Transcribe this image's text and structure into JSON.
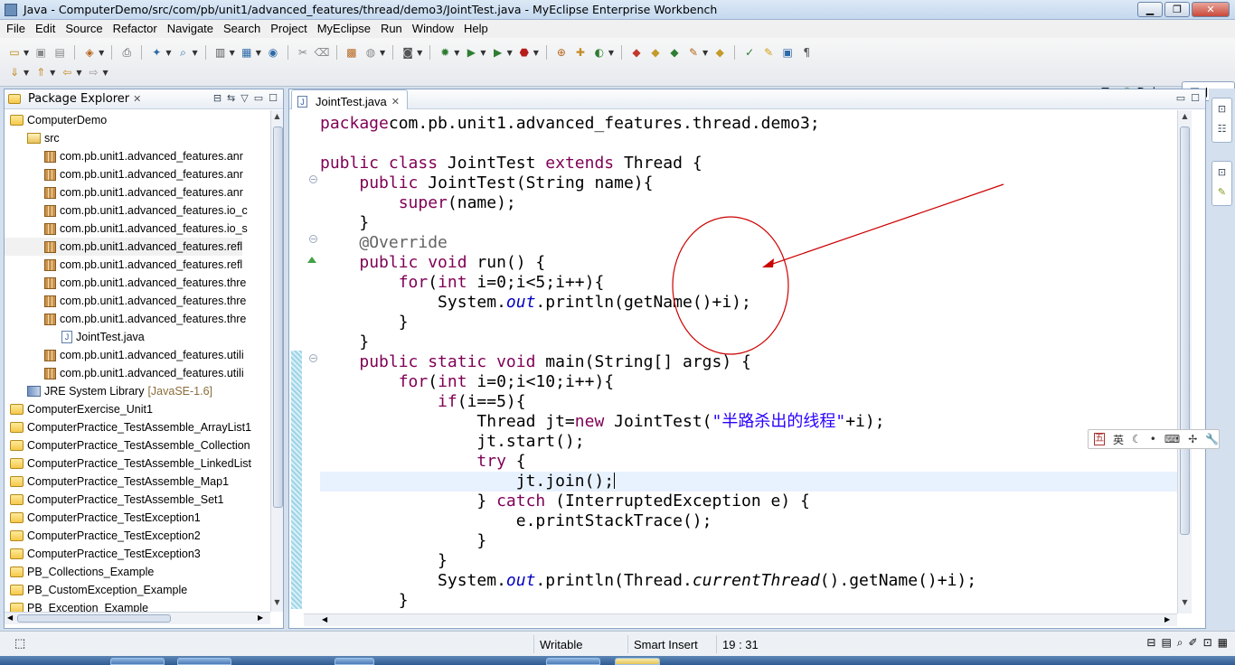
{
  "window": {
    "title": "Java - ComputerDemo/src/com/pb/unit1/advanced_features/thread/demo3/JointTest.java - MyEclipse Enterprise Workbench",
    "minimize": "▁",
    "maximize": "❐",
    "close": "✕"
  },
  "menu": [
    "File",
    "Edit",
    "Source",
    "Refactor",
    "Navigate",
    "Search",
    "Project",
    "MyEclipse",
    "Run",
    "Window",
    "Help"
  ],
  "perspectives": {
    "debug": "Debug",
    "java": "Java"
  },
  "package_explorer": {
    "title": "Package Explorer",
    "items": [
      {
        "label": "ComputerDemo",
        "type": "project",
        "indent": 1
      },
      {
        "label": "src",
        "type": "src",
        "indent": 2
      },
      {
        "label": "com.pb.unit1.advanced_features.anr",
        "type": "pkg",
        "indent": 3
      },
      {
        "label": "com.pb.unit1.advanced_features.anr",
        "type": "pkg",
        "indent": 3
      },
      {
        "label": "com.pb.unit1.advanced_features.anr",
        "type": "pkg",
        "indent": 3
      },
      {
        "label": "com.pb.unit1.advanced_features.io_c",
        "type": "pkg",
        "indent": 3
      },
      {
        "label": "com.pb.unit1.advanced_features.io_s",
        "type": "pkg",
        "indent": 3
      },
      {
        "label": "com.pb.unit1.advanced_features.refl",
        "type": "pkg",
        "indent": 3,
        "selected": true
      },
      {
        "label": "com.pb.unit1.advanced_features.refl",
        "type": "pkg",
        "indent": 3
      },
      {
        "label": "com.pb.unit1.advanced_features.thre",
        "type": "pkg",
        "indent": 3
      },
      {
        "label": "com.pb.unit1.advanced_features.thre",
        "type": "pkg",
        "indent": 3
      },
      {
        "label": "com.pb.unit1.advanced_features.thre",
        "type": "pkg",
        "indent": 3
      },
      {
        "label": "JointTest.java",
        "type": "java",
        "indent": 4
      },
      {
        "label": "com.pb.unit1.advanced_features.utili",
        "type": "pkg",
        "indent": 3
      },
      {
        "label": "com.pb.unit1.advanced_features.utili",
        "type": "pkg",
        "indent": 3
      },
      {
        "label": "JRE System Library",
        "extra": "[JavaSE-1.6]",
        "type": "lib",
        "indent": 2
      },
      {
        "label": "ComputerExercise_Unit1",
        "type": "project",
        "indent": 1
      },
      {
        "label": "ComputerPractice_TestAssemble_ArrayList1",
        "type": "project",
        "indent": 1
      },
      {
        "label": "ComputerPractice_TestAssemble_Collection",
        "type": "project",
        "indent": 1
      },
      {
        "label": "ComputerPractice_TestAssemble_LinkedList",
        "type": "project",
        "indent": 1
      },
      {
        "label": "ComputerPractice_TestAssemble_Map1",
        "type": "project",
        "indent": 1
      },
      {
        "label": "ComputerPractice_TestAssemble_Set1",
        "type": "project",
        "indent": 1
      },
      {
        "label": "ComputerPractice_TestException1",
        "type": "project",
        "indent": 1
      },
      {
        "label": "ComputerPractice_TestException2",
        "type": "project",
        "indent": 1
      },
      {
        "label": "ComputerPractice_TestException3",
        "type": "project",
        "indent": 1
      },
      {
        "label": "PB_Collections_Example",
        "type": "project",
        "indent": 1
      },
      {
        "label": "PB_CustomException_Example",
        "type": "project",
        "indent": 1
      },
      {
        "label": "PB_Exception_Example",
        "type": "project",
        "indent": 1
      }
    ]
  },
  "editor": {
    "tab": "JointTest.java",
    "lines": [
      [
        [
          "kw",
          "package"
        ],
        [
          "",
          "com.pb.unit1.advanced_features.thread.demo3;"
        ]
      ],
      [],
      [
        [
          "kw",
          "public class"
        ],
        [
          "",
          " JointTest "
        ],
        [
          "kw",
          "extends"
        ],
        [
          "",
          " Thread {"
        ]
      ],
      [
        [
          "",
          "    "
        ],
        [
          "kw",
          "public"
        ],
        [
          "",
          " JointTest(String name){"
        ]
      ],
      [
        [
          "",
          "        "
        ],
        [
          "kw",
          "super"
        ],
        [
          "",
          "(name);"
        ]
      ],
      [
        [
          "",
          "    }"
        ]
      ],
      [
        [
          "",
          "    "
        ],
        [
          "an",
          "@Override"
        ]
      ],
      [
        [
          "",
          "    "
        ],
        [
          "kw",
          "public void"
        ],
        [
          "",
          " run() {"
        ]
      ],
      [
        [
          "",
          "        "
        ],
        [
          "kw",
          "for"
        ],
        [
          "",
          "("
        ],
        [
          "kw",
          "int"
        ],
        [
          "",
          " i=0;i<5;i++){"
        ]
      ],
      [
        [
          "",
          "            System."
        ],
        [
          "it",
          "out"
        ],
        [
          "",
          ".println(getName()+i);"
        ]
      ],
      [
        [
          "",
          "        }"
        ]
      ],
      [
        [
          "",
          "    }"
        ]
      ],
      [
        [
          "",
          "    "
        ],
        [
          "kw",
          "public static void"
        ],
        [
          "",
          " main(String[] args) {"
        ]
      ],
      [
        [
          "",
          "        "
        ],
        [
          "kw",
          "for"
        ],
        [
          "",
          "("
        ],
        [
          "kw",
          "int"
        ],
        [
          "",
          " i=0;i<10;i++){"
        ]
      ],
      [
        [
          "",
          "            "
        ],
        [
          "kw",
          "if"
        ],
        [
          "",
          "(i==5){"
        ]
      ],
      [
        [
          "",
          "                Thread jt="
        ],
        [
          "kw",
          "new"
        ],
        [
          "",
          " JointTest("
        ],
        [
          "st",
          "\"半路杀出的线程\""
        ],
        [
          "",
          "+i);"
        ]
      ],
      [
        [
          "",
          "                jt.start();"
        ]
      ],
      [
        [
          "",
          "                "
        ],
        [
          "kw",
          "try"
        ],
        [
          "",
          " {"
        ]
      ],
      [
        [
          "",
          "                    jt.join();"
        ]
      ],
      [
        [
          "",
          "                } "
        ],
        [
          "kw",
          "catch"
        ],
        [
          "",
          " (InterruptedException e) {"
        ]
      ],
      [
        [
          "",
          "                    e.printStackTrace();"
        ]
      ],
      [
        [
          "",
          "                }"
        ]
      ],
      [
        [
          "",
          "            }"
        ]
      ],
      [
        [
          "",
          "            System."
        ],
        [
          "it",
          "out"
        ],
        [
          "",
          ".println(Thread."
        ],
        [
          "it2",
          "currentThread"
        ],
        [
          "",
          "().getName()+i);"
        ]
      ],
      [
        [
          "",
          "        }"
        ]
      ]
    ]
  },
  "status": {
    "writable": "Writable",
    "insert_mode": "Smart Insert",
    "position": "19 : 31"
  },
  "ime": {
    "lang": "英",
    "box": "五"
  },
  "colors": {
    "keyword": "#7f0055",
    "string": "#2a00ff",
    "annotation": "#646464",
    "field": "#0000c0",
    "annotation_ink": "#cc0000"
  },
  "icons": [
    "new-icon",
    "save-icon",
    "print-icon",
    "debug-icon",
    "run-icon",
    "search-icon",
    "close-icon",
    "maximize-icon",
    "minimize-icon"
  ]
}
